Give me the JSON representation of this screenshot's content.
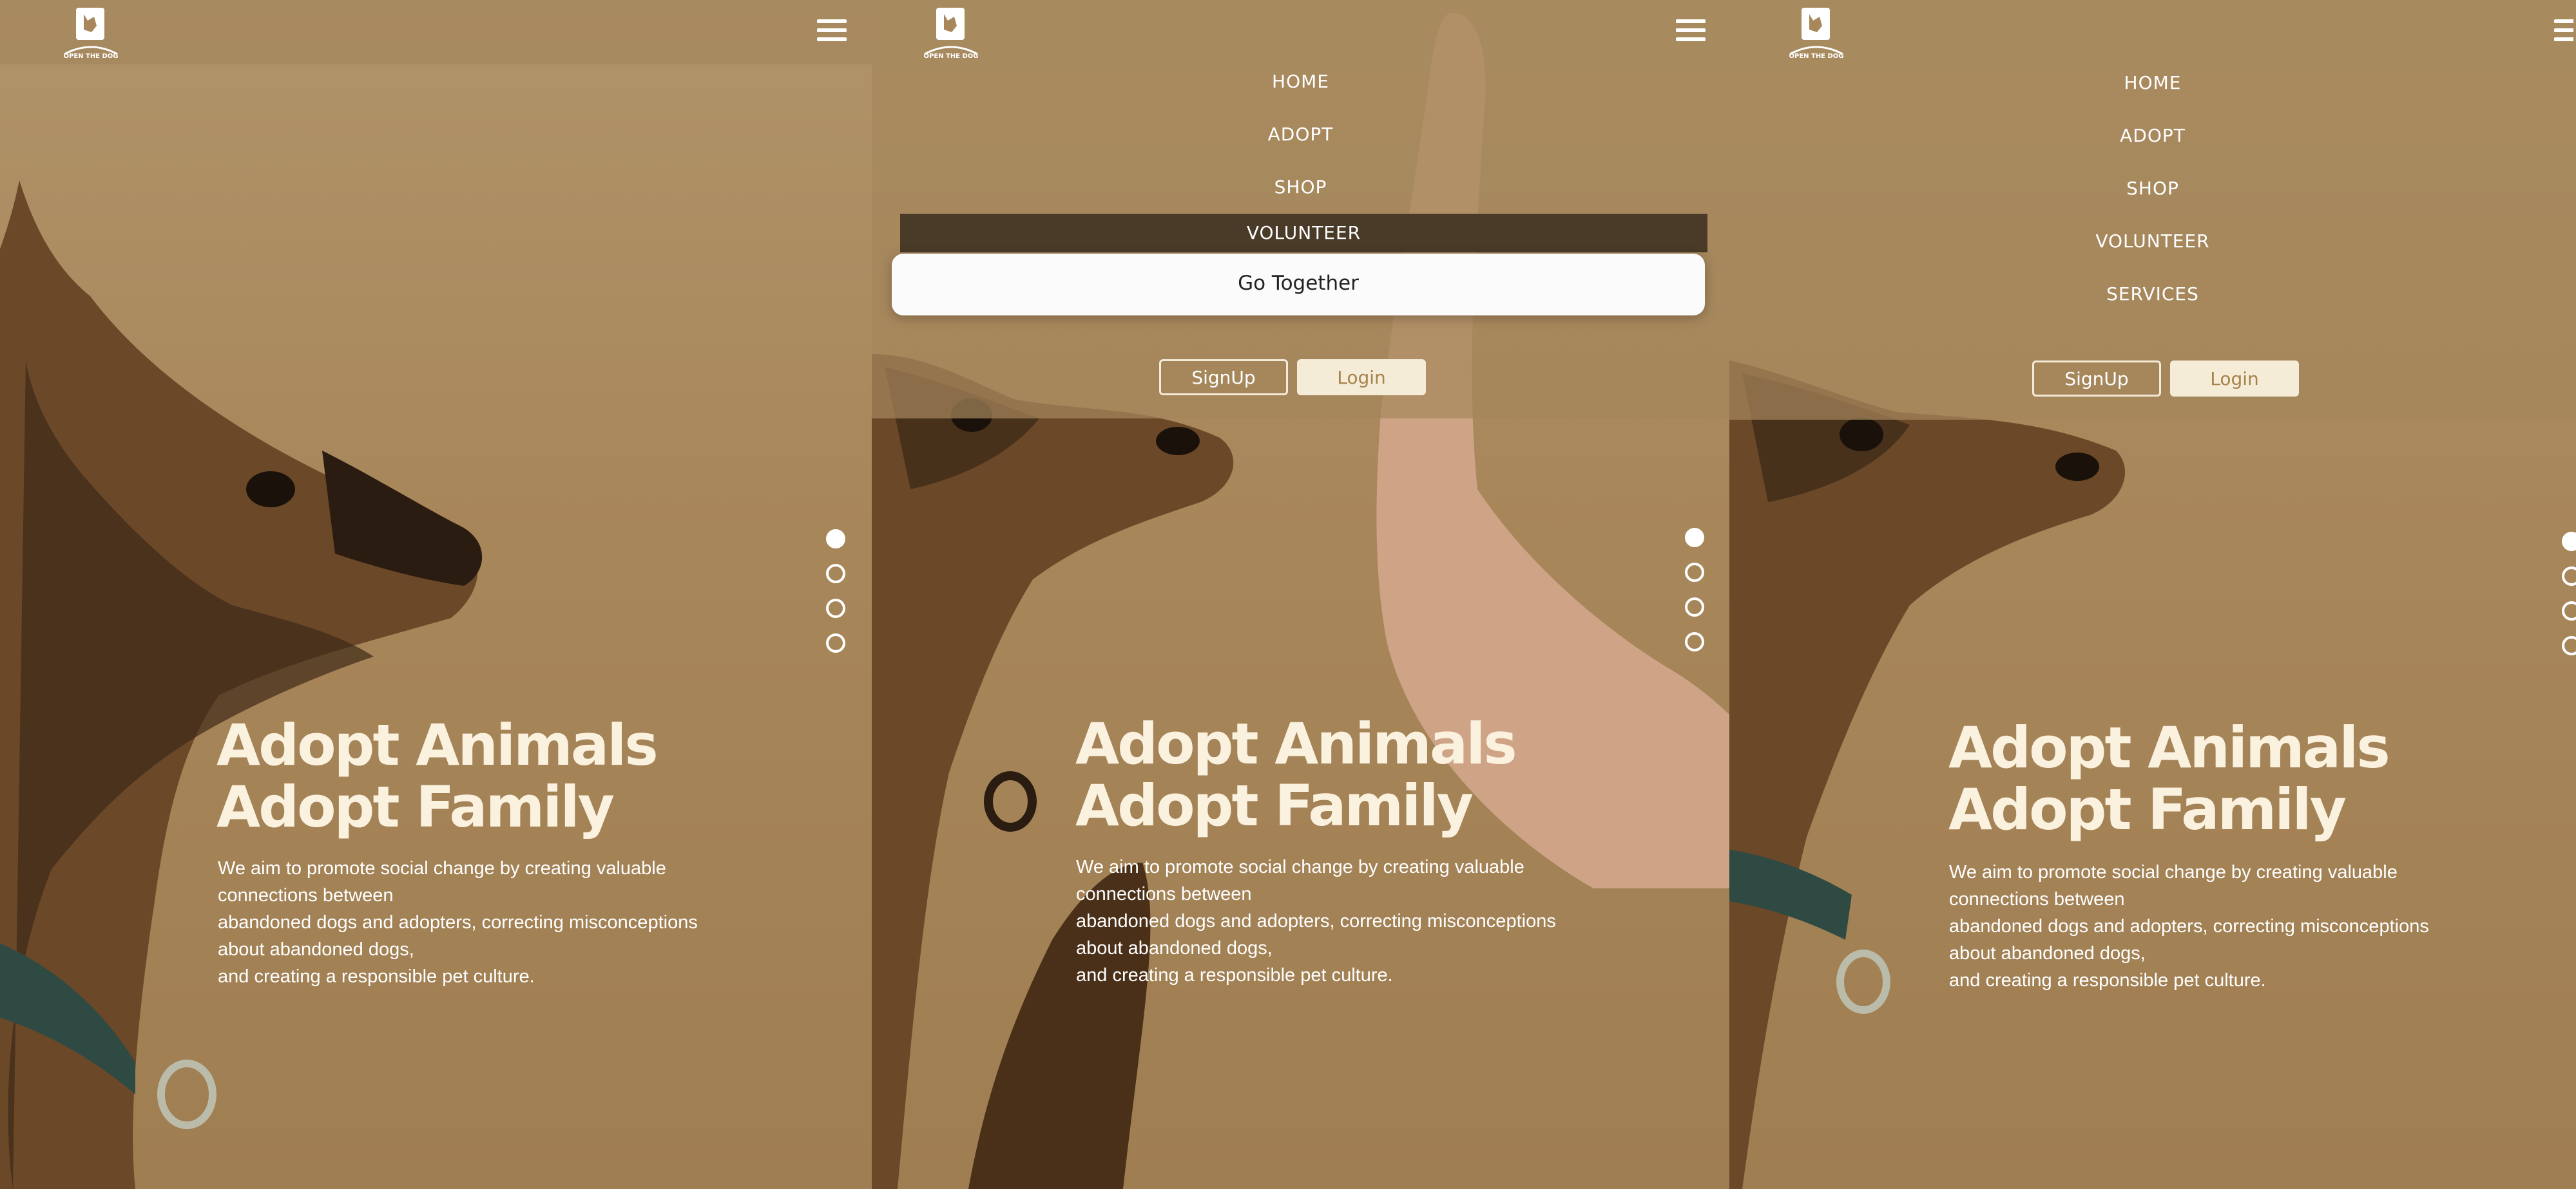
{
  "logo": {
    "label": "OPEN THE DOG"
  },
  "nav": {
    "items": [
      "HOME",
      "ADOPT",
      "SHOP",
      "VOLUNTEER",
      "SERVICES"
    ]
  },
  "tooltip": {
    "label": "Go Together"
  },
  "auth": {
    "signup": "SignUp",
    "login": "Login"
  },
  "hero": {
    "title_line1": "Adopt Animals",
    "title_line2": "Adopt Family",
    "desc": [
      "We aim to promote social change by creating valuable",
      "connections between",
      "abandoned dogs and adopters, correcting misconceptions",
      "about abandoned dogs,",
      "and creating a responsible pet culture."
    ]
  },
  "slider": {
    "count": 4,
    "active_index": 0
  },
  "colors": {
    "accent": "#a7834c",
    "background": "#a8875a",
    "highlight": "#4a3b28",
    "cream": "#f5ecd8"
  }
}
